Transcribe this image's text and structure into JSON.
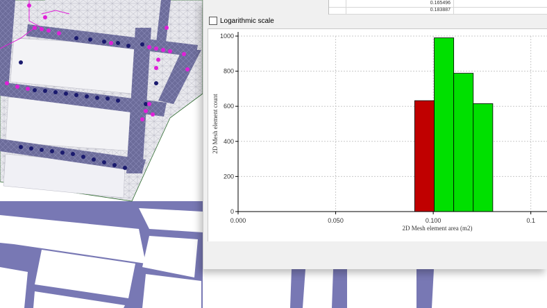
{
  "colors": {
    "road": "#7878b4",
    "mesh_bg": "#e9e9ee",
    "mesh_line": "#b9b9c4",
    "dot_dark": "#1a1a6e",
    "dot_magenta": "#e020d8",
    "bar_red": "#c00000",
    "bar_green": "#00e000"
  },
  "table": {
    "rows": [
      {
        "value": "0.165496"
      },
      {
        "value": "0.183887"
      }
    ]
  },
  "log_scale": {
    "label": "Logarithmic scale",
    "checked": false
  },
  "chart_data": {
    "type": "bar",
    "xlabel": "2D Mesh element area (m2)",
    "ylabel": "2D Mesh element count",
    "xlim": [
      0,
      0.159
    ],
    "ylim": [
      0,
      1000
    ],
    "x_tick_labels": [
      "0.000",
      "0.050",
      "0.100",
      "0.1"
    ],
    "y_tick_labels": [
      "0",
      "200",
      "400",
      "600",
      "800",
      "1000"
    ],
    "bins": [
      {
        "from": 0.0905,
        "to": 0.1005,
        "count": 632,
        "color": "#c00000"
      },
      {
        "from": 0.1005,
        "to": 0.1105,
        "count": 990,
        "color": "#00e000"
      },
      {
        "from": 0.1105,
        "to": 0.1205,
        "count": 788,
        "color": "#00e000"
      },
      {
        "from": 0.1205,
        "to": 0.1305,
        "count": 615,
        "color": "#00e000"
      }
    ],
    "grid": true
  }
}
